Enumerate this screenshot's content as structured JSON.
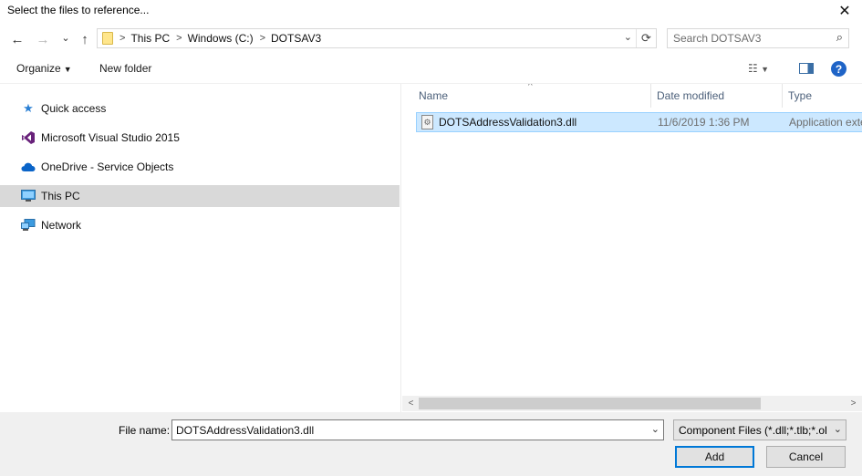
{
  "window": {
    "title": "Select the files to reference...",
    "close_glyph": "✕"
  },
  "nav": {
    "back_glyph": "←",
    "forward_glyph": "→",
    "recent_glyph": "⌄",
    "up_glyph": "↑"
  },
  "address": {
    "crumbs": [
      "This PC",
      "Windows (C:)",
      "DOTSAV3"
    ],
    "separator": ">",
    "refresh_glyph": "⟳"
  },
  "search": {
    "placeholder": "Search DOTSAV3"
  },
  "toolbar": {
    "organize_label": "Organize",
    "new_folder_label": "New folder",
    "help_glyph": "?"
  },
  "sidebar": {
    "items": [
      {
        "label": "Quick access",
        "icon": "star-icon"
      },
      {
        "label": "Microsoft Visual Studio 2015",
        "icon": "visual-studio-icon"
      },
      {
        "label": "OneDrive - Service Objects",
        "icon": "cloud-icon"
      },
      {
        "label": "This PC",
        "icon": "monitor-icon",
        "selected": true
      },
      {
        "label": "Network",
        "icon": "network-icon"
      }
    ]
  },
  "files": {
    "columns": [
      "Name",
      "Date modified",
      "Type"
    ],
    "rows": [
      {
        "name": "DOTSAddressValidation3.dll",
        "date": "11/6/2019 1:36 PM",
        "type": "Application extension"
      }
    ]
  },
  "bottom": {
    "file_name_label": "File name:",
    "file_name_value": "DOTSAddressValidation3.dll",
    "filter_value": "Component Files (*.dll;*.tlb;*.ol",
    "add_label": "Add",
    "cancel_label": "Cancel"
  },
  "colors": {
    "selection_bg": "#cce8ff",
    "selection_border": "#99d1ff",
    "nav_selected": "#d9d9d9",
    "accent": "#0078d7"
  }
}
